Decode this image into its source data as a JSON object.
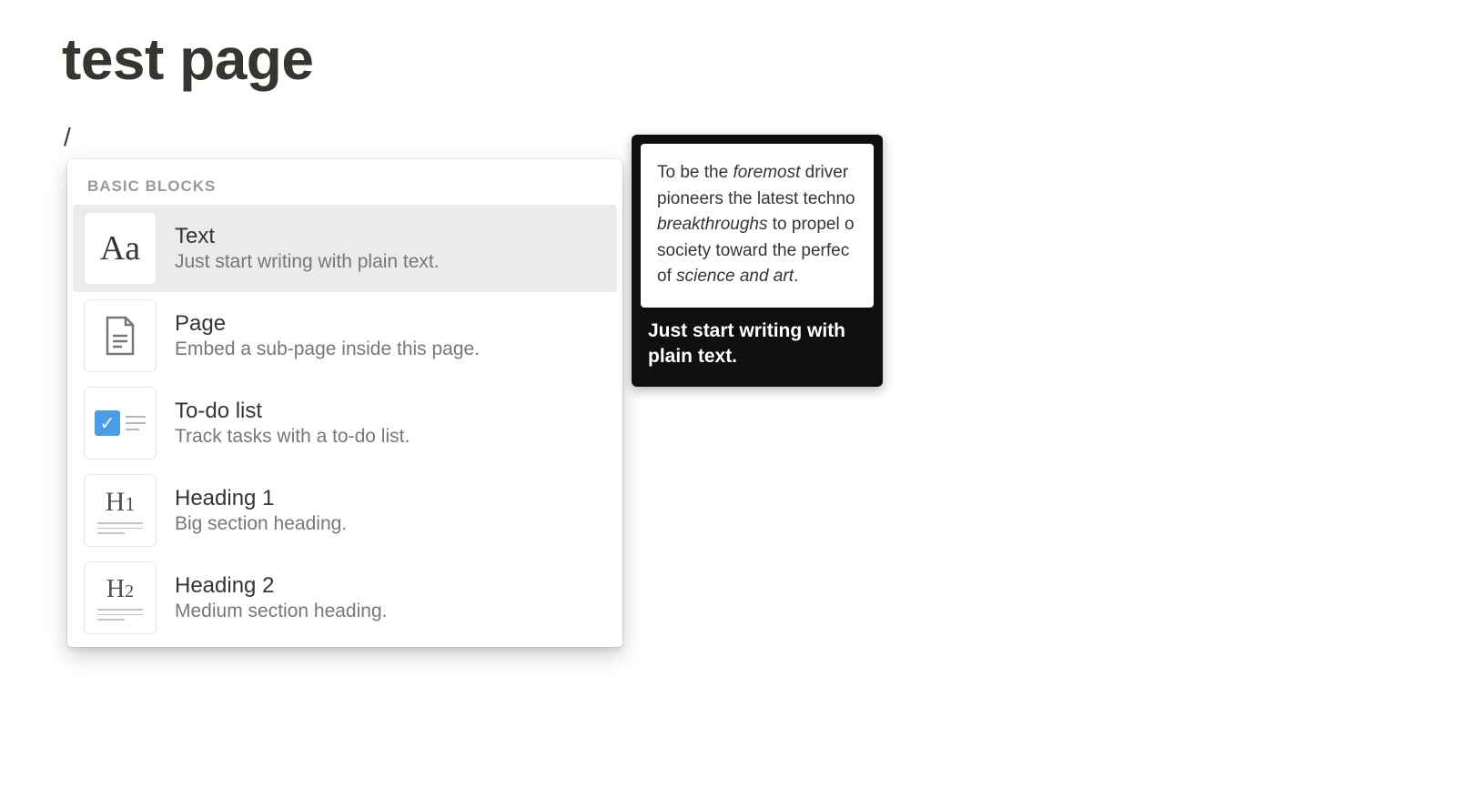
{
  "page": {
    "title": "test page",
    "input": "/"
  },
  "menu": {
    "section_label": "BASIC BLOCKS",
    "items": [
      {
        "title": "Text",
        "description": "Just start writing with plain text.",
        "selected": true,
        "icon": "text"
      },
      {
        "title": "Page",
        "description": "Embed a sub-page inside this page.",
        "selected": false,
        "icon": "page"
      },
      {
        "title": "To-do list",
        "description": "Track tasks with a to-do list.",
        "selected": false,
        "icon": "todo"
      },
      {
        "title": "Heading 1",
        "description": "Big section heading.",
        "selected": false,
        "icon": "h1"
      },
      {
        "title": "Heading 2",
        "description": "Medium section heading.",
        "selected": false,
        "icon": "h2"
      }
    ]
  },
  "tooltip": {
    "preview_html": "To be the <em>foremost</em> driver pioneers the latest techno <em>breakthroughs</em> to propel o society toward the perfec of <em>science and art</em>.",
    "caption": "Just start writing with plain text."
  }
}
